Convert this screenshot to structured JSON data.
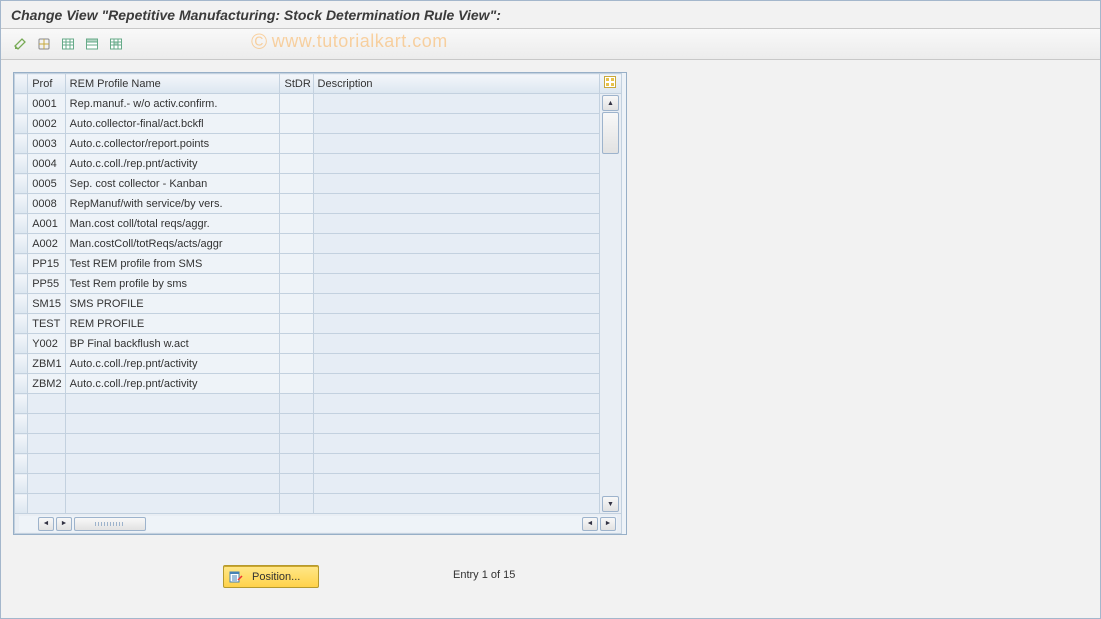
{
  "title": "Change View \"Repetitive Manufacturing: Stock Determination Rule View\":",
  "watermark": "www.tutorialkart.com",
  "toolbar": {
    "icons": [
      "display-change-icon",
      "other-view-icon",
      "table-icon",
      "select-all-icon",
      "select-block-icon"
    ]
  },
  "columns": {
    "prof": "Prof",
    "name": "REM Profile Name",
    "stdr": "StDR",
    "desc": "Description"
  },
  "rows": [
    {
      "prof": "0001",
      "name": "Rep.manuf.- w/o activ.confirm.",
      "stdr": "",
      "desc": ""
    },
    {
      "prof": "0002",
      "name": "Auto.collector-final/act.bckfl",
      "stdr": "",
      "desc": ""
    },
    {
      "prof": "0003",
      "name": "Auto.c.collector/report.points",
      "stdr": "",
      "desc": ""
    },
    {
      "prof": "0004",
      "name": "Auto.c.coll./rep.pnt/activity",
      "stdr": "",
      "desc": ""
    },
    {
      "prof": "0005",
      "name": "Sep. cost collector - Kanban",
      "stdr": "",
      "desc": ""
    },
    {
      "prof": "0008",
      "name": "RepManuf/with service/by vers.",
      "stdr": "",
      "desc": ""
    },
    {
      "prof": "A001",
      "name": "Man.cost coll/total reqs/aggr.",
      "stdr": "",
      "desc": ""
    },
    {
      "prof": "A002",
      "name": "Man.costColl/totReqs/acts/aggr",
      "stdr": "",
      "desc": ""
    },
    {
      "prof": "PP15",
      "name": "Test REM profile from SMS",
      "stdr": "",
      "desc": ""
    },
    {
      "prof": "PP55",
      "name": "Test Rem profile by sms",
      "stdr": "",
      "desc": ""
    },
    {
      "prof": "SM15",
      "name": "SMS PROFILE",
      "stdr": "",
      "desc": ""
    },
    {
      "prof": "TEST",
      "name": "REM PROFILE",
      "stdr": "",
      "desc": ""
    },
    {
      "prof": "Y002",
      "name": "BP Final backflush w.act",
      "stdr": "",
      "desc": ""
    },
    {
      "prof": "ZBM1",
      "name": "Auto.c.coll./rep.pnt/activity",
      "stdr": "",
      "desc": ""
    },
    {
      "prof": "ZBM2",
      "name": "Auto.c.coll./rep.pnt/activity",
      "stdr": "",
      "desc": ""
    }
  ],
  "empty_rows": 6,
  "footer": {
    "position_label": "Position...",
    "entry_text": "Entry 1 of 15"
  }
}
